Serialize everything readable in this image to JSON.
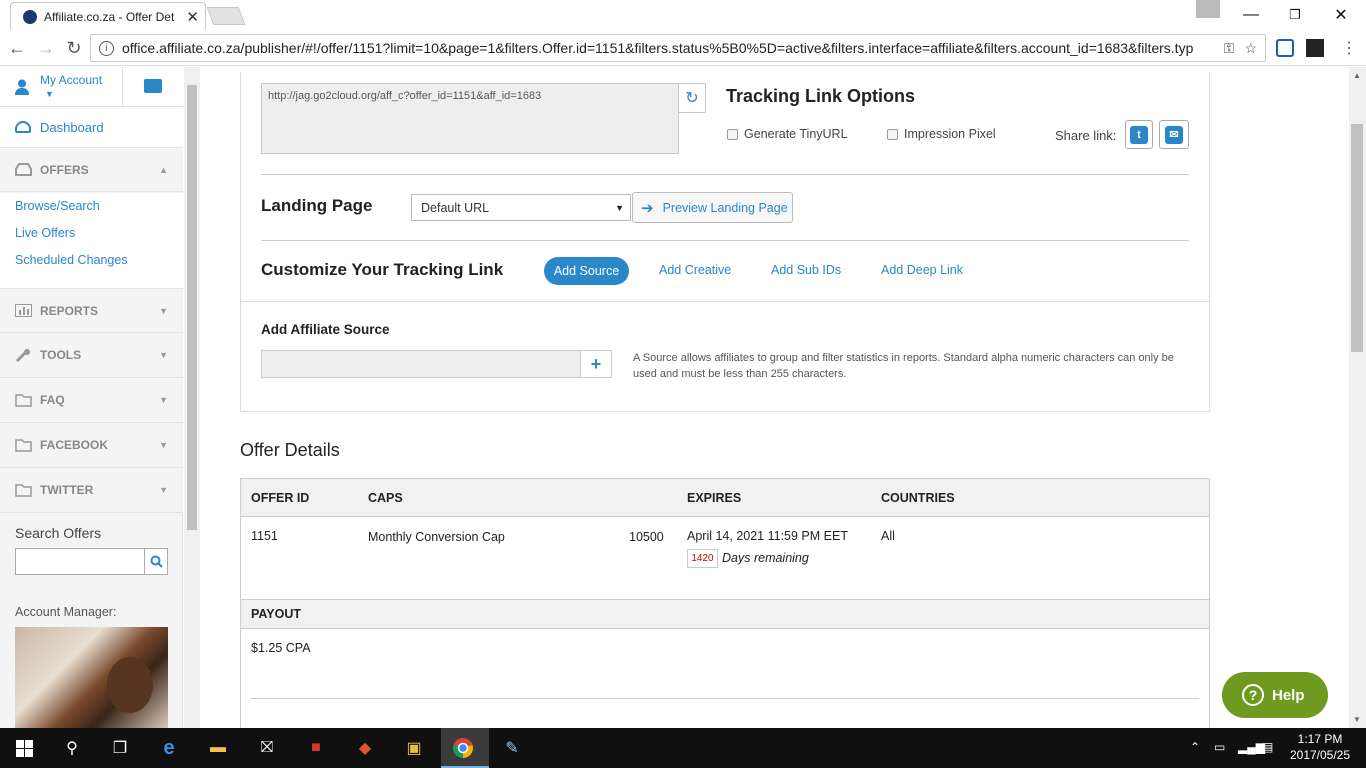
{
  "browser": {
    "tab_title": "Affiliate.co.za - Offer Det",
    "url": "office.affiliate.co.za/publisher/#!/offer/1151?limit=10&page=1&filters.Offer.id=1151&filters.status%5B0%5D=active&filters.interface=affiliate&filters.account_id=1683&filters.typ"
  },
  "sidebar": {
    "my_account": "My Account",
    "dashboard": "Dashboard",
    "offers": "OFFERS",
    "offer_links": [
      "Browse/Search",
      "Live Offers",
      "Scheduled Changes"
    ],
    "reports": "REPORTS",
    "tools": "TOOLS",
    "faq": "FAQ",
    "facebook": "FACEBOOK",
    "twitter": "TWITTER",
    "search_label": "Search Offers",
    "search_value": "",
    "account_manager": "Account Manager:"
  },
  "tracking": {
    "link": "http://jag.go2cloud.org/aff_c?offer_id=1151&aff_id=1683",
    "options_title": "Tracking Link Options",
    "tinyurl": "Generate TinyURL",
    "impression": "Impression Pixel",
    "share": "Share link:",
    "landing_label": "Landing Page",
    "landing_value": "Default URL",
    "preview": "Preview Landing Page",
    "customize": "Customize Your Tracking Link",
    "add_source": "Add Source",
    "add_creative": "Add Creative",
    "add_subids": "Add Sub IDs",
    "add_deeplink": "Add Deep Link",
    "source_title": "Add Affiliate Source",
    "source_value": "",
    "source_help": "A Source allows affiliates to group and filter statistics in reports. Standard alpha numeric characters can only be used and must be less than 255 characters."
  },
  "offer": {
    "title": "Offer Details",
    "headers": [
      "OFFER ID",
      "CAPS",
      "EXPIRES",
      "COUNTRIES"
    ],
    "id": "1151",
    "cap_label": "Monthly Conversion Cap",
    "cap_value": "10500",
    "expires": "April 14, 2021 11:59 PM EET",
    "days": "1420",
    "days_label": "Days remaining",
    "countries": "All",
    "payout_header": "PAYOUT",
    "payout": "$1.25  CPA"
  },
  "help": "Help",
  "taskbar": {
    "time": "1:17 PM",
    "date": "2017/05/25"
  }
}
